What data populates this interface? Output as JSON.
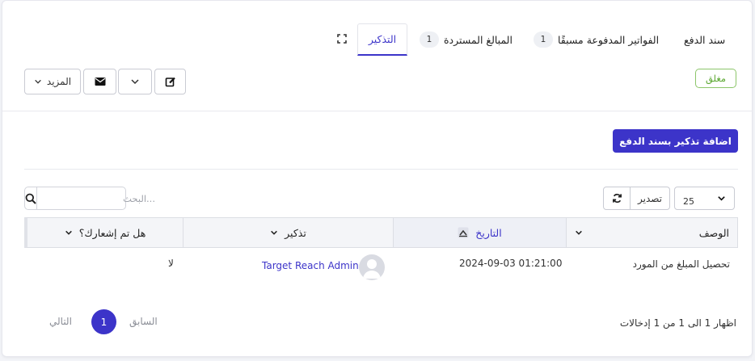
{
  "tabs": [
    {
      "label": "سند الدفع",
      "badge": ""
    },
    {
      "label": "الفواتير المدفوعة مسبقًا",
      "badge": "1"
    },
    {
      "label": "المبالغ المستردة",
      "badge": "1"
    },
    {
      "label": "التذكير",
      "badge": ""
    }
  ],
  "status": {
    "label": "مغلق",
    "color": "#5aa730"
  },
  "toolbar": {
    "more_label": "المزيد"
  },
  "actions": {
    "add_reminder_label": "اضافة تذكير بسند الدفع"
  },
  "table_controls": {
    "page_size": "25",
    "export_label": "تصدير",
    "search_placeholder": "البحث..."
  },
  "table": {
    "columns": [
      {
        "label": "الوصف"
      },
      {
        "label": "التاريخ"
      },
      {
        "label": "تذكير"
      },
      {
        "label": "هل تم إشعارك؟"
      }
    ],
    "rows": [
      {
        "description": "تحصيل المبلغ من المورد",
        "date": "2024-09-03 01:21:00",
        "reminder_user": "Target Reach Admin",
        "notified": "لا"
      }
    ]
  },
  "footer": {
    "summary": "اظهار 1 الى 1 من 1 إدخالات",
    "prev_label": "السابق",
    "current_page": "1",
    "next_label": "التالي"
  },
  "colors": {
    "accent": "#3c34c9",
    "status_green": "#5aa730"
  }
}
